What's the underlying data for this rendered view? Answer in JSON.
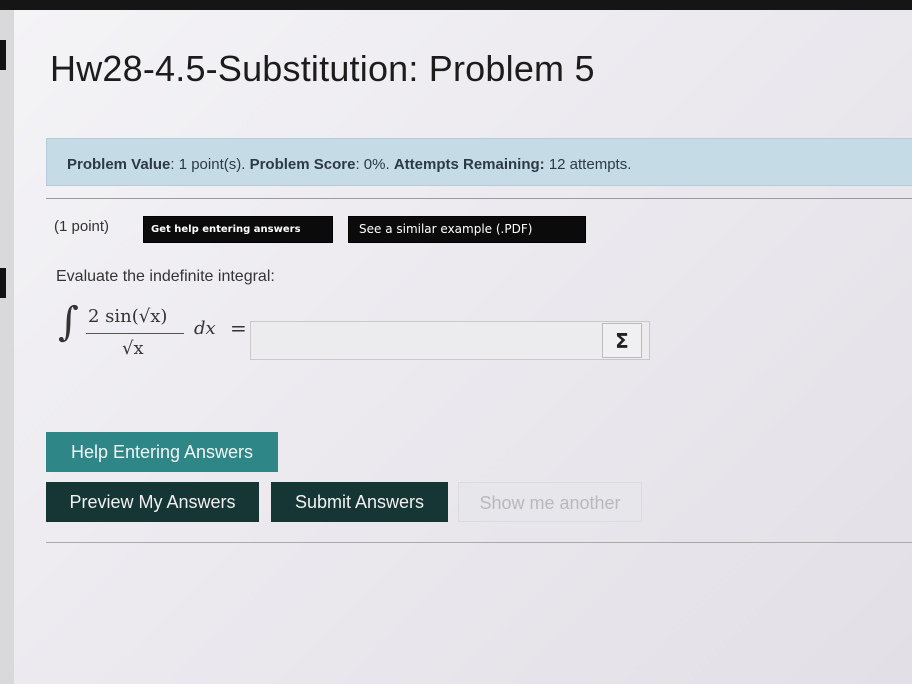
{
  "page": {
    "title": "Hw28-4.5-Substitution: Problem 5"
  },
  "problem_info": {
    "value_label": "Problem Value",
    "value_text": ": 1 point(s). ",
    "score_label": "Problem Score",
    "score_text": ": 0%. ",
    "attempts_label": "Attempts Remaining:",
    "attempts_text": " 12 attempts."
  },
  "problem": {
    "points": "(1 point)",
    "help_link": "Get help entering answers",
    "example_link": "See a similar example (.PDF)",
    "instruction": "Evaluate the indefinite integral:",
    "math": {
      "integral": "∫",
      "numerator": "2 sin(√x)",
      "denominator": "√x",
      "differential": "dx",
      "equals": "="
    },
    "answer_value": "",
    "sigma_icon": "Σ"
  },
  "buttons": {
    "help_entering": "Help Entering Answers",
    "preview": "Preview My Answers",
    "submit": "Submit Answers",
    "show_another": "Show me another"
  },
  "colors": {
    "score_bar": "#c5dbe6",
    "help_button": "#2f8686",
    "dark_button": "#163535",
    "disabled_button": "#e7e6ea"
  }
}
